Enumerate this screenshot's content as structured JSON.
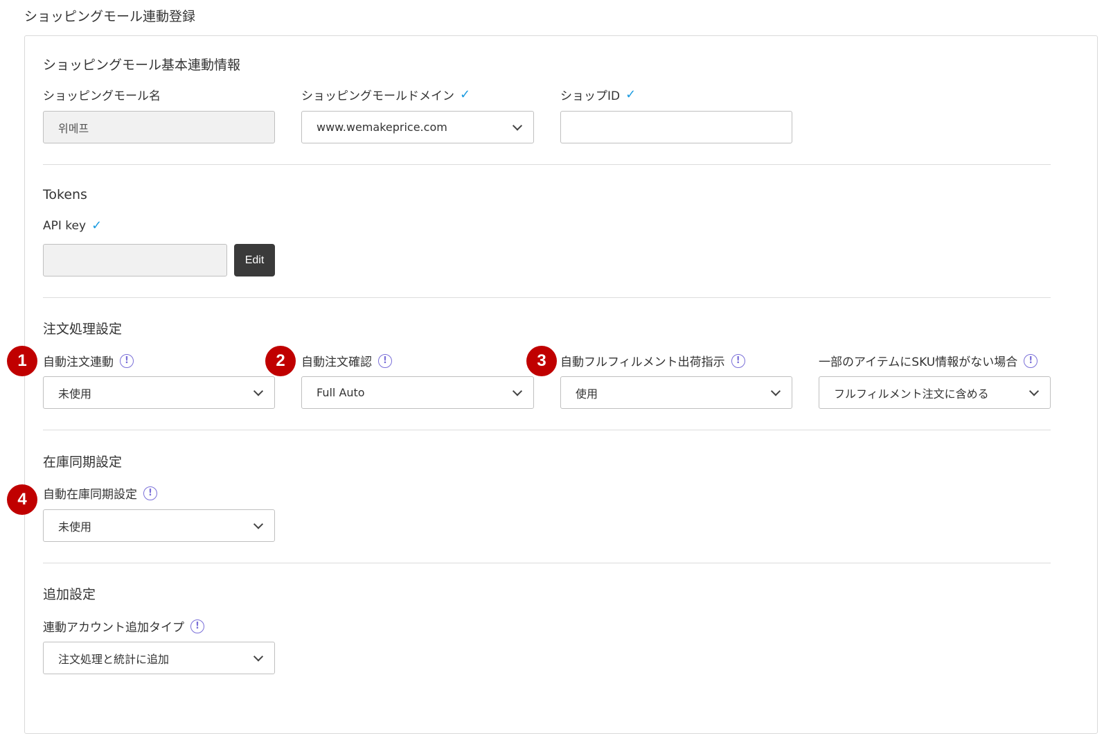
{
  "page_title": "ショッピングモール連動登録",
  "basic": {
    "section_title": "ショッピングモール基本連動情報",
    "mall_name_label": "ショッピングモール名",
    "mall_name_value": "위메프",
    "domain_label": "ショッピングモールドメイン",
    "domain_value": "www.wemakeprice.com",
    "shop_id_label": "ショップID",
    "shop_id_value": ""
  },
  "tokens": {
    "section_title": "Tokens",
    "api_key_label": "API key",
    "api_key_value": "",
    "edit_label": "Edit"
  },
  "order": {
    "section_title": "注文処理設定",
    "auto_order_link_label": "自動注文連動",
    "auto_order_link_value": "未使用",
    "auto_order_confirm_label": "自動注文確認",
    "auto_order_confirm_value": "Full Auto",
    "auto_fulfillment_label": "自動フルフィルメント出荷指示",
    "auto_fulfillment_value": "使用",
    "no_sku_label": "一部のアイテムにSKU情報がない場合",
    "no_sku_value": "フルフィルメント注文に含める"
  },
  "inventory": {
    "section_title": "在庫同期設定",
    "auto_sync_label": "自動在庫同期設定",
    "auto_sync_value": "未使用"
  },
  "additional": {
    "section_title": "追加設定",
    "account_type_label": "連動アカウント追加タイプ",
    "account_type_value": "注文処理と統計に追加"
  },
  "badges": [
    "1",
    "2",
    "3",
    "4"
  ],
  "icons": {
    "check": "checkmark-icon",
    "info": "info-circle-icon",
    "dropdown": "chevron-down-icon"
  },
  "colors": {
    "check": "#1a9be0",
    "info": "#7a6fd8",
    "badge": "#c00000",
    "edit_button": "#3a3a3a"
  }
}
